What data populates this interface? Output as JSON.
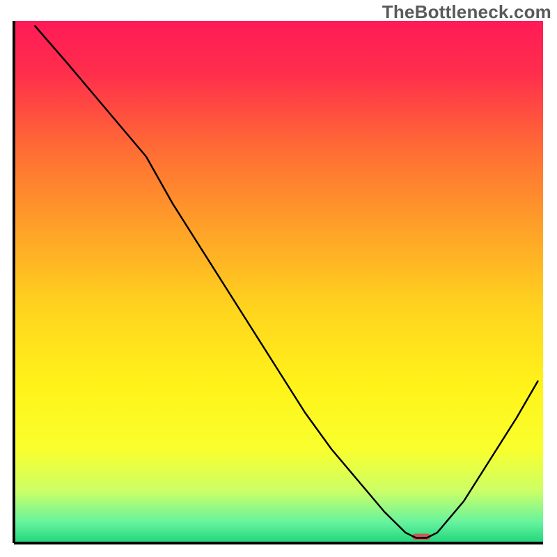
{
  "watermark": "TheBottleneck.com",
  "chart_data": {
    "type": "line",
    "title": "",
    "xlabel": "",
    "ylabel": "",
    "xlim": [
      0,
      100
    ],
    "ylim": [
      0,
      100
    ],
    "grid": false,
    "series": [
      {
        "name": "trace",
        "x": [
          4,
          10,
          15,
          20,
          25,
          30,
          35,
          40,
          45,
          50,
          55,
          60,
          65,
          70,
          74,
          76,
          78,
          80,
          85,
          90,
          95,
          99
        ],
        "y": [
          99,
          92,
          86,
          80,
          74,
          65,
          57,
          49,
          41,
          33,
          25,
          18,
          12,
          6,
          2,
          1,
          1,
          2,
          8,
          16,
          24,
          31
        ],
        "color": "#000000",
        "width": 2.5
      }
    ],
    "background_gradient": {
      "stops": [
        {
          "offset": 0.0,
          "color": "#ff1a57"
        },
        {
          "offset": 0.1,
          "color": "#ff2e4c"
        },
        {
          "offset": 0.25,
          "color": "#ff6e34"
        },
        {
          "offset": 0.4,
          "color": "#ffa228"
        },
        {
          "offset": 0.55,
          "color": "#ffd41e"
        },
        {
          "offset": 0.7,
          "color": "#fff31a"
        },
        {
          "offset": 0.82,
          "color": "#f9ff2d"
        },
        {
          "offset": 0.9,
          "color": "#ccff66"
        },
        {
          "offset": 0.96,
          "color": "#66f39e"
        },
        {
          "offset": 1.0,
          "color": "#1fd67a"
        }
      ]
    },
    "marker": {
      "x": 77,
      "y": 1.2,
      "width_ratio": 0.035,
      "height_ratio": 0.012,
      "rx_ratio": 0.006,
      "color": "#c85a5a"
    },
    "border_color": "#000000",
    "border_width": 4
  }
}
